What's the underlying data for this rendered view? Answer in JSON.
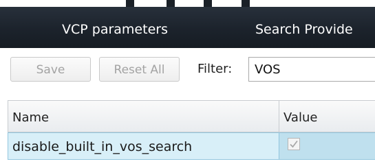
{
  "tabs": [
    {
      "label": "VCP parameters"
    },
    {
      "label": "Search Provide"
    }
  ],
  "toolbar": {
    "save_label": "Save",
    "reset_label": "Reset All",
    "filter_label": "Filter:",
    "filter_value": "VOS"
  },
  "table": {
    "columns": [
      "Name",
      "Value"
    ],
    "rows": [
      {
        "name": "disable_built_in_vos_search",
        "value_checked": true
      }
    ]
  },
  "colors": {
    "header_bg": "#1c232c",
    "selected_row": "#c8e4f1"
  }
}
